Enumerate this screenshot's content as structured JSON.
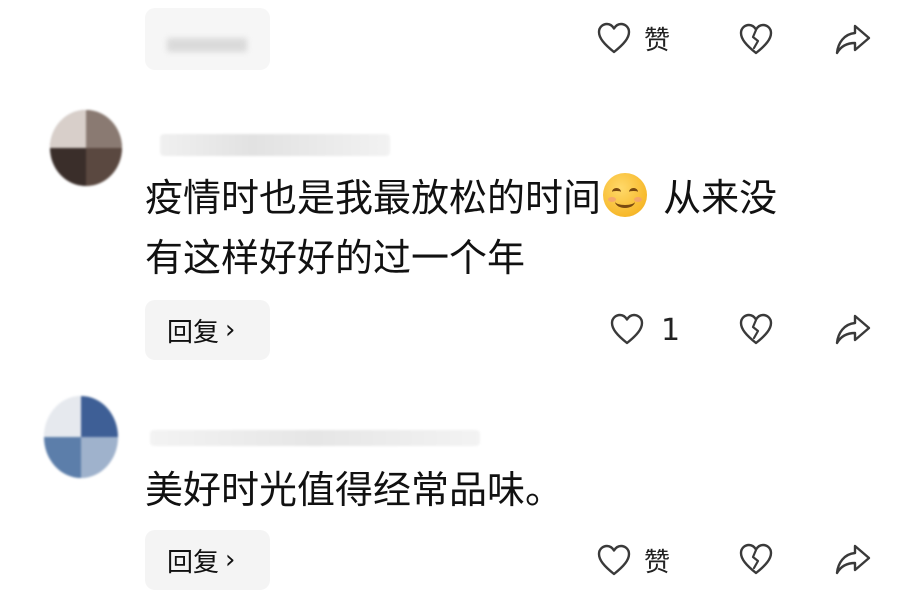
{
  "top_row": {
    "like_label": "赞"
  },
  "comments": [
    {
      "text_line1": "疫情时也是我最放松的时间",
      "text_line1_after_emoji": " 从来没",
      "text_line2": "有这样好好的过一个年",
      "emoji": "smiling-face-emoji",
      "reply_label": "回复",
      "reply_chevron": "›",
      "like_count": "1"
    },
    {
      "text_line1": "美好时光值得经常品味。",
      "reply_label": "回复",
      "reply_chevron": "›",
      "like_label": "赞"
    }
  ],
  "icons": {
    "like": "heart-outline-icon",
    "dislike": "broken-heart-icon",
    "share": "share-arrow-icon"
  },
  "colors": {
    "background": "#ffffff",
    "text": "#111111",
    "icon": "#3a3a3a",
    "reply_bg": "#f4f4f4"
  }
}
